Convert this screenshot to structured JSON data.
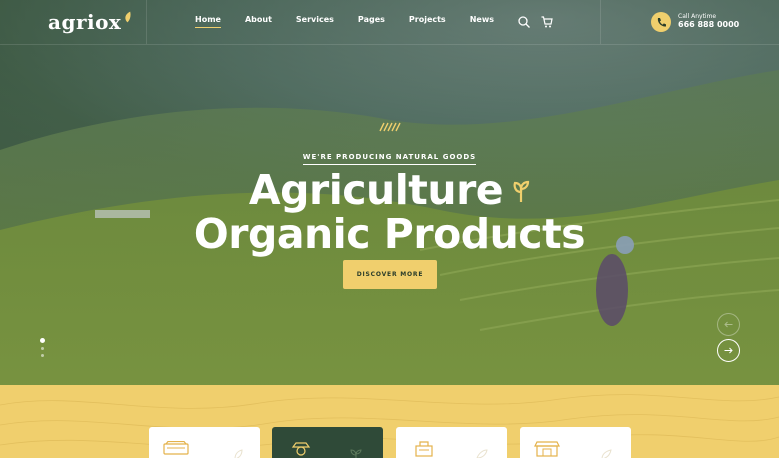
{
  "brand": {
    "name": "agriox"
  },
  "nav": {
    "items": [
      "Home",
      "About",
      "Services",
      "Pages",
      "Projects",
      "News"
    ],
    "active": "Home"
  },
  "contact": {
    "label": "Call Anytime",
    "phone": "666 888 0000"
  },
  "hero": {
    "tagline": "WE'RE PRODUCING NATURAL GOODS",
    "title_line1": "Agriculture",
    "title_line2": "Organic Products",
    "cta": "DISCOVER MORE"
  },
  "slider": {
    "slides": 3,
    "active_slide": 1
  },
  "colors": {
    "accent": "#f0cf6d",
    "dark_green": "#2f4a38",
    "white": "#ffffff"
  },
  "icons": [
    "search-icon",
    "cart-icon",
    "phone-icon",
    "wheat-icon",
    "arrow-left-icon",
    "arrow-right-icon",
    "tractor-icon",
    "farmer-icon",
    "vegetables-icon",
    "market-icon"
  ]
}
